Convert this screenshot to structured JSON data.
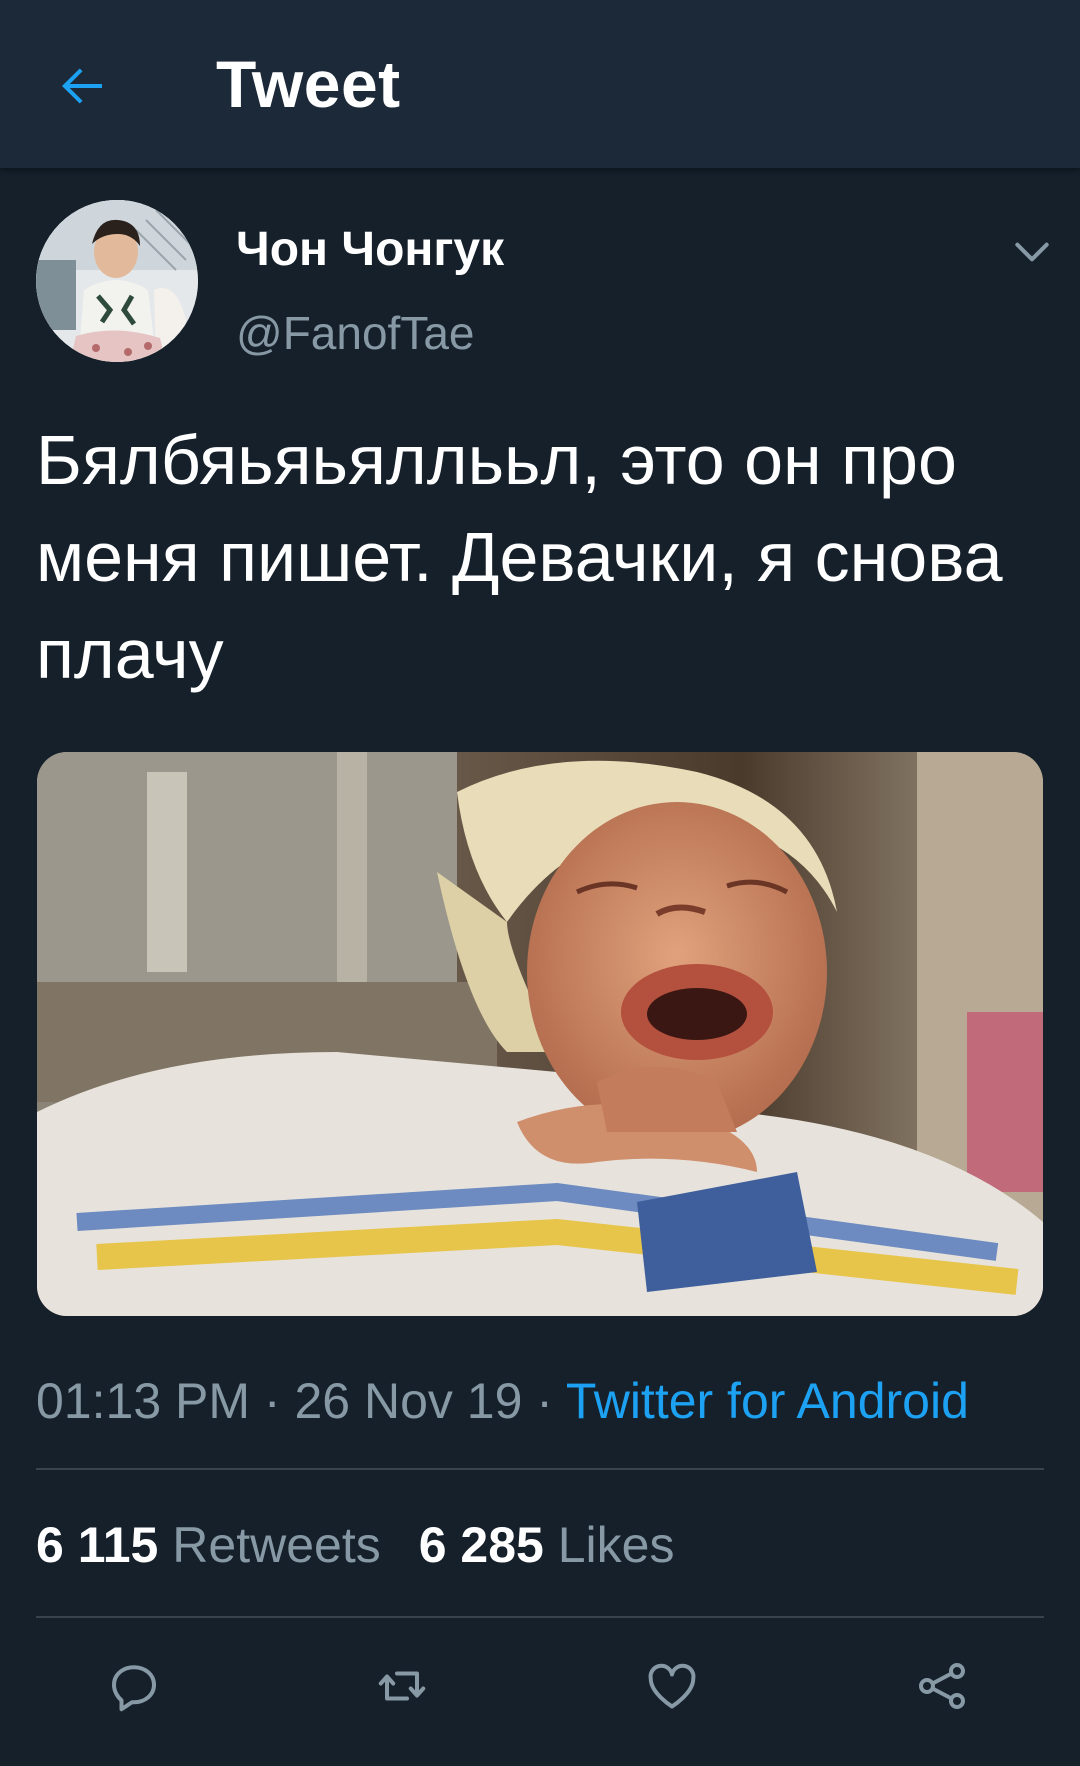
{
  "header": {
    "title": "Tweet",
    "back_icon": "arrow-left-icon",
    "accent_color": "#1da1f2"
  },
  "tweet": {
    "author_name": "Чон Чонгук",
    "author_handle": "@FanofTae",
    "text": "Бялбяьяьяллььл, это он про меня пишет. Девачки, я снова плачу",
    "time": "01:13 PM",
    "separator": " · ",
    "date": "26 Nov 19",
    "source": "Twitter for Android",
    "retweets_count": "6 115",
    "retweets_label": "Retweets",
    "likes_count": "6 285",
    "likes_label": "Likes"
  },
  "actions": [
    {
      "name": "reply",
      "icon": "reply-icon"
    },
    {
      "name": "retweet",
      "icon": "retweet-icon"
    },
    {
      "name": "like",
      "icon": "heart-icon"
    },
    {
      "name": "share",
      "icon": "share-icon"
    }
  ],
  "colors": {
    "background": "#15202b",
    "topbar": "#1c2938",
    "secondary_text": "#8899a6",
    "link": "#1da1f2",
    "divider": "#38444d"
  }
}
